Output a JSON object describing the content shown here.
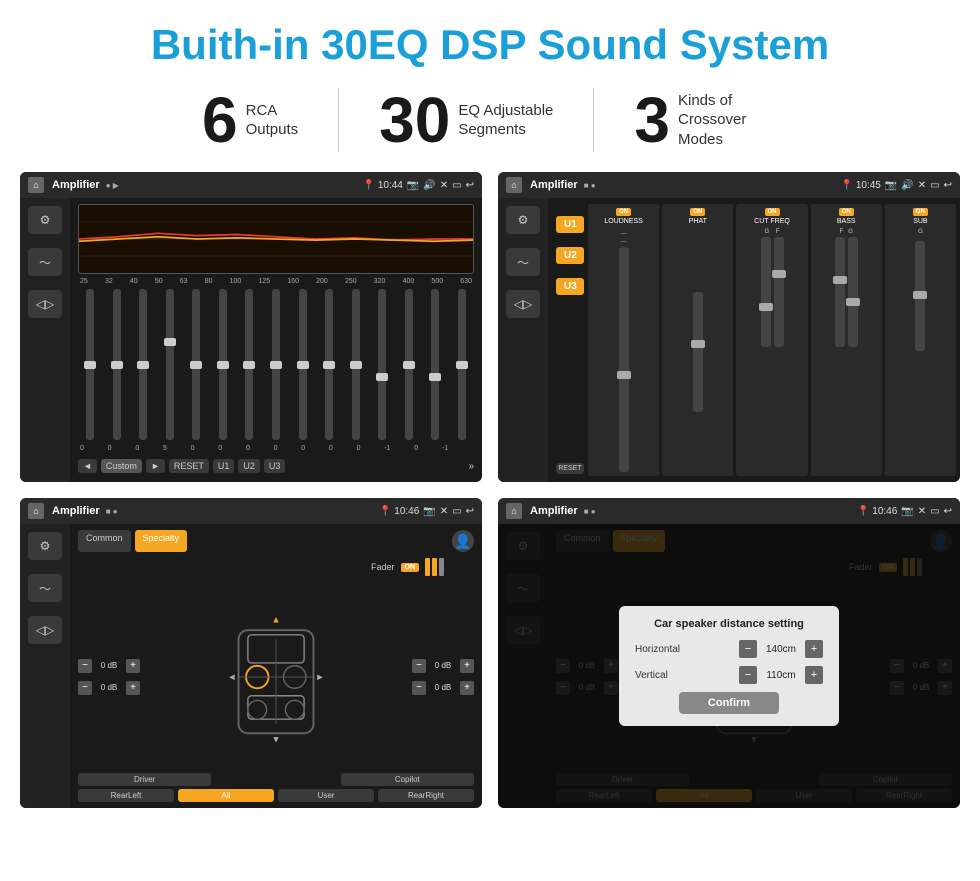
{
  "header": {
    "title": "Buith-in 30EQ DSP Sound System"
  },
  "stats": [
    {
      "number": "6",
      "label": "RCA\nOutputs"
    },
    {
      "number": "30",
      "label": "EQ Adjustable\nSegments"
    },
    {
      "number": "3",
      "label": "Kinds of\nCrossover Modes"
    }
  ],
  "screens": [
    {
      "id": "screen1",
      "statusBar": {
        "title": "Amplifier",
        "time": "10:44",
        "icons": "📷 🔊 ✕ ▭ ↩"
      },
      "eqFreqs": [
        "25",
        "32",
        "40",
        "50",
        "63",
        "80",
        "100",
        "125",
        "160",
        "200",
        "250",
        "320",
        "400",
        "500",
        "630"
      ],
      "eqVals": [
        "0",
        "0",
        "0",
        "5",
        "0",
        "0",
        "0",
        "0",
        "0",
        "0",
        "0",
        "-1",
        "0",
        "-1"
      ],
      "bottomBtns": [
        "◄",
        "Custom",
        "►",
        "RESET",
        "U1",
        "U2",
        "U3"
      ]
    },
    {
      "id": "screen2",
      "statusBar": {
        "title": "Amplifier",
        "time": "10:45"
      },
      "uButtons": [
        "U1",
        "U2",
        "U3"
      ],
      "columns": [
        {
          "label": "LOUDNESS",
          "on": true
        },
        {
          "label": "PHAT",
          "on": true
        },
        {
          "label": "CUT FREQ",
          "on": true
        },
        {
          "label": "BASS",
          "on": true
        },
        {
          "label": "SUB",
          "on": true
        }
      ],
      "resetBtn": "RESET"
    },
    {
      "id": "screen3",
      "statusBar": {
        "title": "Amplifier",
        "time": "10:46"
      },
      "tabs": [
        "Common",
        "Specialty"
      ],
      "activeTab": "Specialty",
      "fader": {
        "label": "Fader",
        "on": true
      },
      "speakerControls": {
        "topLeft": "0 dB",
        "bottomLeft": "0 dB",
        "topRight": "0 dB",
        "bottomRight": "0 dB"
      },
      "bottomBtns": [
        "Driver",
        "",
        "Copilot",
        "RearLeft",
        "All",
        "User",
        "RearRight"
      ]
    },
    {
      "id": "screen4",
      "statusBar": {
        "title": "Amplifier",
        "time": "10:46"
      },
      "tabs": [
        "Common",
        "Specialty"
      ],
      "dialog": {
        "title": "Car speaker distance setting",
        "horizontal": {
          "label": "Horizontal",
          "value": "140cm"
        },
        "vertical": {
          "label": "Vertical",
          "value": "110cm"
        },
        "confirmBtn": "Confirm"
      },
      "speakerControls": {
        "topRight": "0 dB",
        "bottomRight": "0 dB"
      },
      "bottomBtns": [
        "Driver",
        "Copilot",
        "RearLeft",
        "User",
        "RearRight"
      ]
    }
  ]
}
